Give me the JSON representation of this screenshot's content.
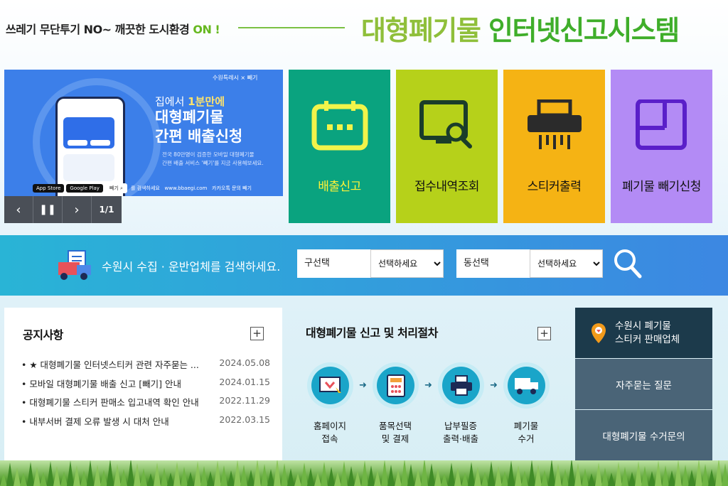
{
  "header": {
    "slogan": "쓰레기 무단투기 NO~ 깨끗한 도시환경",
    "slogan_on": "ON !",
    "title_part1": "대형폐기물",
    "title_part2": "인터넷신고시스템"
  },
  "banner": {
    "logos": "수원특례시 × 빼기",
    "subtitle_prefix": "집에서 ",
    "subtitle_highlight": "1분만에",
    "headline_line1": "대형폐기물",
    "headline_line2": "간편 배출신청",
    "desc_line1": "전국 80만명이 검증한 모바일 대형폐기물",
    "desc_line2": "간편 배출 서비스 '빼기'를 지금 사용해보세요.",
    "store1": "App Store",
    "store2": "Google Play",
    "search_word": "빼기",
    "search_hint": "를 검색하세요",
    "site": "www.bbaegi.com",
    "kakao": "카카오톡 문의 빼기",
    "counter": "1/1"
  },
  "services": [
    {
      "label": "배출신고",
      "icon": "calendar-icon"
    },
    {
      "label": "접수내역조회",
      "icon": "monitor-search-icon"
    },
    {
      "label": "스티커출력",
      "icon": "printer-shredder-icon"
    },
    {
      "label": "폐기물 빼기신청",
      "icon": "square-frame-icon"
    }
  ],
  "search": {
    "text": "수원시 수집 · 운반업체를 검색하세요.",
    "gu_label": "구선택",
    "gu_value": "선택하세요",
    "dong_label": "동선택",
    "dong_value": "선택하세요"
  },
  "notice": {
    "title": "공지사항",
    "items": [
      {
        "title": "★ 대형폐기물 인터넷스티커 관련 자주묻는 ...",
        "date": "2024.05.08"
      },
      {
        "title": "모바일 대형폐기물 배출 신고 [빼기] 안내",
        "date": "2024.01.15"
      },
      {
        "title": "대형폐기물 스티커 판매소 입고내역 확인 안내",
        "date": "2022.11.29"
      },
      {
        "title": "내부서버 결제 오류 발생 시 대처 안내",
        "date": "2022.03.15"
      }
    ]
  },
  "process": {
    "title": "대형폐기물 신고 및 처리절차",
    "steps": [
      {
        "line1": "홈페이지",
        "line2": "접속"
      },
      {
        "line1": "품목선택",
        "line2": "및 결제"
      },
      {
        "line1": "납부필증",
        "line2": "출력·배출"
      },
      {
        "line1": "폐기물",
        "line2": "수거"
      }
    ]
  },
  "side_menu": {
    "item1_line1": "수원시 폐기물",
    "item1_line2": "스티커 판매업체",
    "item2": "자주묻는 질문",
    "item3": "대형폐기물 수거문의"
  },
  "colors": {
    "tile1": "#0aa37f",
    "tile2": "#b6d11a",
    "tile3": "#f5b314",
    "tile4": "#b38bf5",
    "title_green": "#6ab62b"
  }
}
